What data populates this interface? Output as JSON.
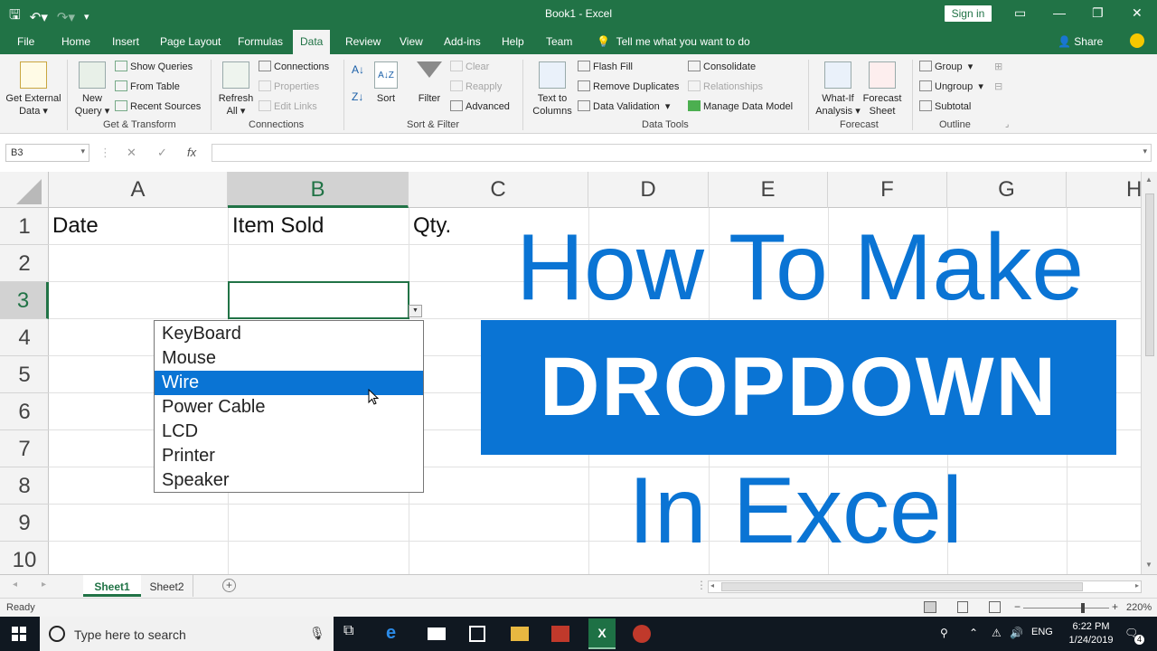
{
  "titlebar": {
    "title": "Book1 - Excel",
    "sign_in": "Sign in"
  },
  "tabs": [
    "File",
    "Home",
    "Insert",
    "Page Layout",
    "Formulas",
    "Data",
    "Review",
    "View",
    "Add-ins",
    "Help",
    "Team"
  ],
  "active_tab": "Data",
  "tell_me": "Tell me what you want to do",
  "share": "Share",
  "ribbon": {
    "get_external_data": [
      "Get External",
      "Data ▾"
    ],
    "new_query": [
      "New",
      "Query ▾"
    ],
    "show_queries": "Show Queries",
    "from_table": "From Table",
    "recent_sources": "Recent Sources",
    "refresh_all": [
      "Refresh",
      "All ▾"
    ],
    "connections": "Connections",
    "properties": "Properties",
    "edit_links": "Edit Links",
    "sort_az": "A↓Z",
    "sort": "Sort",
    "filter": "Filter",
    "clear": "Clear",
    "reapply": "Reapply",
    "advanced": "Advanced",
    "text_to_columns": [
      "Text to",
      "Columns"
    ],
    "flash_fill": "Flash Fill",
    "remove_duplicates": "Remove Duplicates",
    "data_validation": "Data Validation",
    "consolidate": "Consolidate",
    "relationships": "Relationships",
    "manage_data_model": "Manage Data Model",
    "what_if": [
      "What-If",
      "Analysis ▾"
    ],
    "forecast_sheet": [
      "Forecast",
      "Sheet"
    ],
    "group": "Group",
    "ungroup": "Ungroup",
    "subtotal": "Subtotal",
    "groups": {
      "get_transform": "Get & Transform",
      "connections": "Connections",
      "sort_filter": "Sort & Filter",
      "data_tools": "Data Tools",
      "forecast": "Forecast",
      "outline": "Outline"
    }
  },
  "formula_bar": {
    "name_box": "B3",
    "cancel": "✕",
    "enter": "✓",
    "fx": "fx",
    "value": ""
  },
  "columns": [
    "A",
    "B",
    "C",
    "D",
    "E",
    "F",
    "G",
    "H"
  ],
  "selected_column": "B",
  "rows": [
    "1",
    "2",
    "3",
    "4",
    "5",
    "6",
    "7",
    "8",
    "9",
    "10"
  ],
  "selected_row": "3",
  "cells": {
    "A1": "Date",
    "B1": "Item Sold",
    "C1": "Qty."
  },
  "dropdown": {
    "items": [
      "KeyBoard",
      "Mouse",
      "Wire",
      "Power Cable",
      "LCD",
      "Printer",
      "Speaker"
    ],
    "selected": "Wire"
  },
  "overlay": {
    "line1": "How To Make",
    "banner": "DROPDOWN",
    "line3": "In Excel"
  },
  "sheets": [
    "Sheet1",
    "Sheet2"
  ],
  "active_sheet": "Sheet1",
  "status": {
    "text": "Ready",
    "zoom": "220%"
  },
  "taskbar": {
    "search_placeholder": "Type here to search",
    "language": "ENG",
    "time": "6:22 PM",
    "date": "1/24/2019",
    "notifications": "4"
  },
  "colors": {
    "excel_green": "#217346",
    "accent_blue": "#0a74d4"
  }
}
